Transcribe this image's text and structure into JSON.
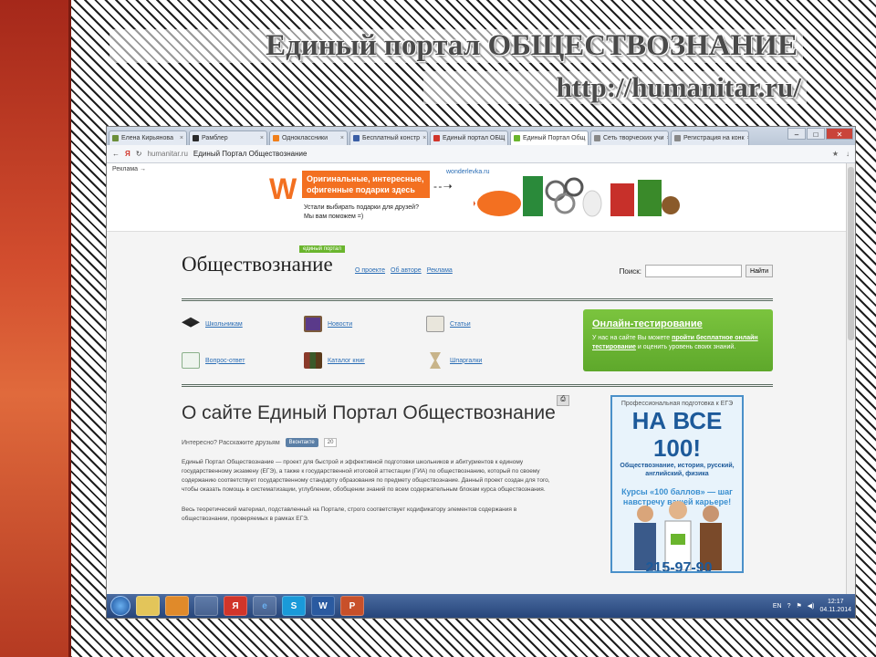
{
  "slide": {
    "title": "Единый портал ОБЩЕСТВОЗНАНИЕ",
    "url": "http://humanitar.ru/"
  },
  "browser": {
    "tabs": [
      {
        "label": "Елена Кирьянова",
        "color": "#6b8e3a"
      },
      {
        "label": "Рамблер",
        "color": "#2a2a2a"
      },
      {
        "label": "Одноклассники",
        "color": "#f07f1a"
      },
      {
        "label": "Бесплатный констр",
        "color": "#3a5ea5"
      },
      {
        "label": "Единый портал ОБЩ",
        "color": "#d1352a"
      },
      {
        "label": "Единый Портал Общ",
        "color": "#6ab52d"
      },
      {
        "label": "Сеть творческих учи",
        "color": "#888888"
      },
      {
        "label": "Регистрация на конк",
        "color": "#888888"
      }
    ],
    "address": {
      "url": "humanitar.ru",
      "title": "Единый Портал Обществознание"
    }
  },
  "ad": {
    "label": "Реклама →",
    "logo": "W",
    "banner": "Оригинальные, интересные, офигенные подарки здесь",
    "sub1": "Устали выбирать подарки для друзей?",
    "sub2": "Мы вам поможем =)",
    "site": "wonderlevka.ru"
  },
  "site": {
    "tag": "единый портал",
    "brand": "Обществознание",
    "links": [
      "О проекте",
      "Об авторе",
      "Реклама"
    ],
    "search_label": "Поиск:",
    "search_button": "Найти",
    "nav": [
      {
        "label": "Школьникам",
        "icon": "graduation-cap-icon"
      },
      {
        "label": "Новости",
        "icon": "tv-icon"
      },
      {
        "label": "Статьи",
        "icon": "book-icon"
      },
      {
        "label": "Вопрос-ответ",
        "icon": "document-icon"
      },
      {
        "label": "Каталог книг",
        "icon": "books-icon"
      },
      {
        "label": "Шпаргалки",
        "icon": "hourglass-icon"
      }
    ],
    "online": {
      "title": "Онлайн-тестирование",
      "text_pre": "У нас на сайте Вы можете",
      "text_link": "пройти бесплатное онлайн тестирование",
      "text_post": "и оценить уровень своих знаний."
    },
    "heading": "О сайте Единый Портал Обществознание",
    "share_label": "Интересно? Расскажите друзьям",
    "vk_label": "Вконтакте",
    "vk_count": "20",
    "para1": "Единый Портал Обществознание — проект для быстрой и эффективной подготовки школьников и абитуриентов к единому государственному экзамену (ЕГЭ), а также к государственной итоговой аттестации (ГИА) по обществознанию, который по своему содержанию соответствует государственному стандарту образования по предмету обществознание. Данный проект создан для того, чтобы оказать помощь в систематизации, углублении, обобщении знаний по всем содержательным блокам курса обществознания.",
    "para2": "Весь теоретический материал, подставленный на Портале, строго соответствует кодификатору элементов содержания в обществознании, проверяемых в рамках ЕГЭ.",
    "side_ad": {
      "top": "Профессиональная подготовка к ЕГЭ",
      "big": "НА ВСЕ 100!",
      "sub": "Обществознание, история, русский, английский, физика",
      "mid": "Курсы «100 баллов» — шаг навстречу вашей карьере!",
      "phone": "215-97-90"
    }
  },
  "taskbar": {
    "apps": [
      "",
      "",
      "",
      "Я",
      "e",
      "S",
      "W",
      "P"
    ],
    "lang": "EN",
    "time": "12:17",
    "date": "04.11.2014"
  }
}
